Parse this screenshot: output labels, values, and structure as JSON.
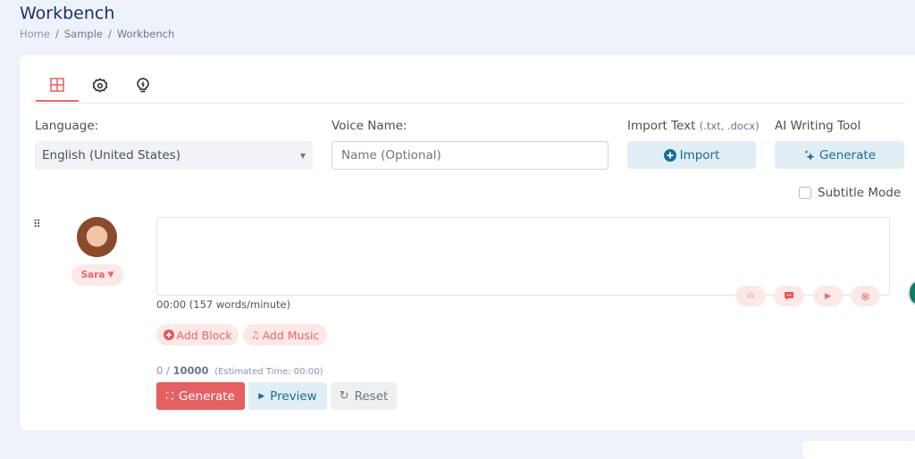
{
  "header": {
    "title": "Workbench",
    "breadcrumb": [
      "Home",
      "Sample",
      "Workbench"
    ]
  },
  "tabs": [
    {
      "icon": "grid-icon",
      "active": true
    },
    {
      "icon": "gear-icon"
    },
    {
      "icon": "lightbulb-icon"
    }
  ],
  "form": {
    "language_label": "Language:",
    "language_value": "English (United States)",
    "voice_label": "Voice Name:",
    "voice_placeholder": "Name (Optional)",
    "import_label": "Import Text",
    "import_hint": "(.txt, .docx)",
    "import_button": "Import",
    "ai_label": "AI Writing Tool",
    "ai_button": "Generate",
    "subtitle_mode": "Subtitle Mode",
    "subtitle_checked": false
  },
  "block": {
    "voice": "Sara",
    "text": "",
    "duration": "00:00 (157 words/minute)"
  },
  "actions": {
    "add_block": "Add Block",
    "add_music": "Add Music"
  },
  "counter": {
    "count": "0",
    "sep": " / ",
    "max": "10000",
    "estimate": "(Estimated Time: 00:00)"
  },
  "buttons": {
    "generate": "Generate",
    "preview": "Preview",
    "reset": "Reset"
  },
  "colors": {
    "accent": "#e8676a",
    "primary": "#1a6b99",
    "title": "#1d3266"
  }
}
